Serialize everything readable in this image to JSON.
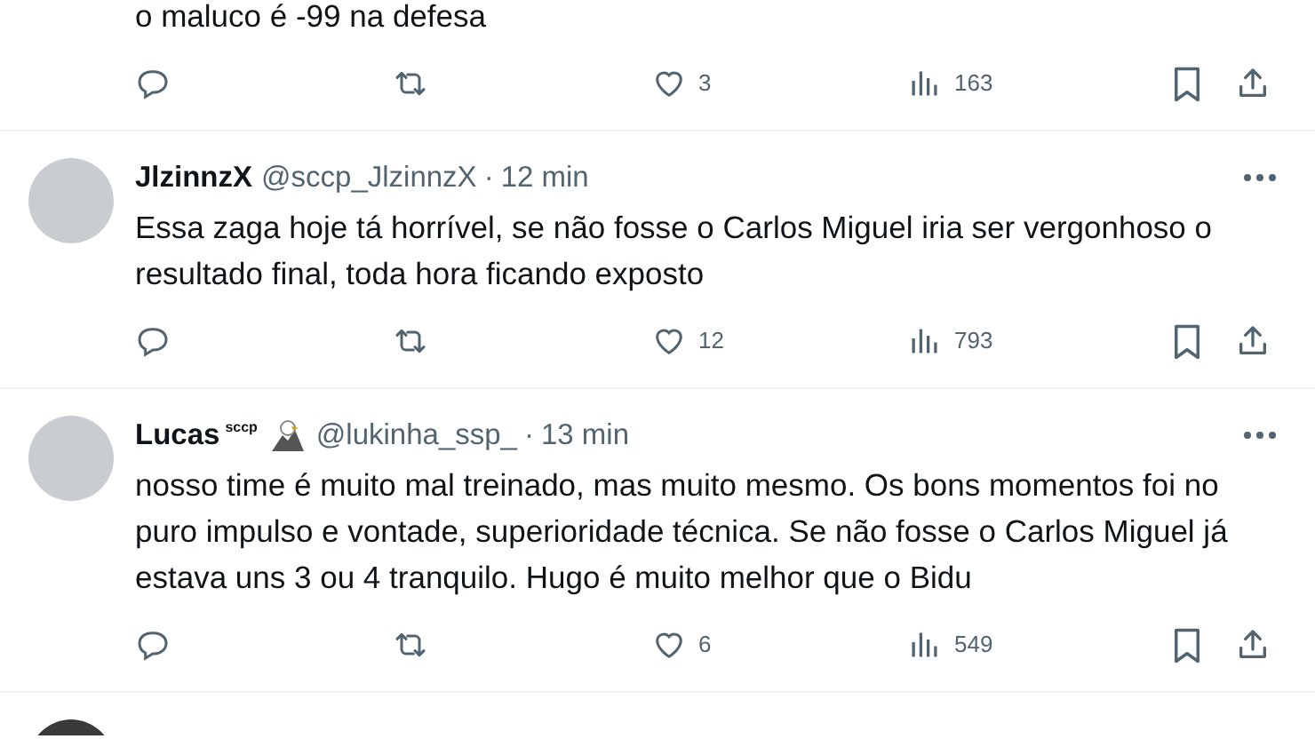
{
  "tweets": [
    {
      "partial": true,
      "text": "o maluco é -99 na defesa",
      "stats": {
        "likes": "3",
        "views": "163"
      }
    },
    {
      "partial": false,
      "name": "JlzinnzX",
      "handle": "@sccp_JlzinnzX",
      "sep": "·",
      "time": "12 min",
      "text": "Essa zaga hoje tá horrível, se não fosse o Carlos Miguel iria ser vergonhoso o resultado final, toda hora ficando exposto",
      "stats": {
        "likes": "12",
        "views": "793"
      }
    },
    {
      "partial": false,
      "name": "Lucas",
      "name_tag": "sccp",
      "eagle_badge": true,
      "handle": "@lukinha_ssp_",
      "sep": "·",
      "time": "13 min",
      "text": "nosso time é muito mal treinado, mas muito mesmo. Os bons momentos foi no puro impulso e vontade, superioridade técnica. Se não fosse o Carlos Miguel já estava uns 3 ou 4 tranquilo. Hugo é muito melhor que o Bidu",
      "stats": {
        "likes": "6",
        "views": "549"
      }
    }
  ]
}
